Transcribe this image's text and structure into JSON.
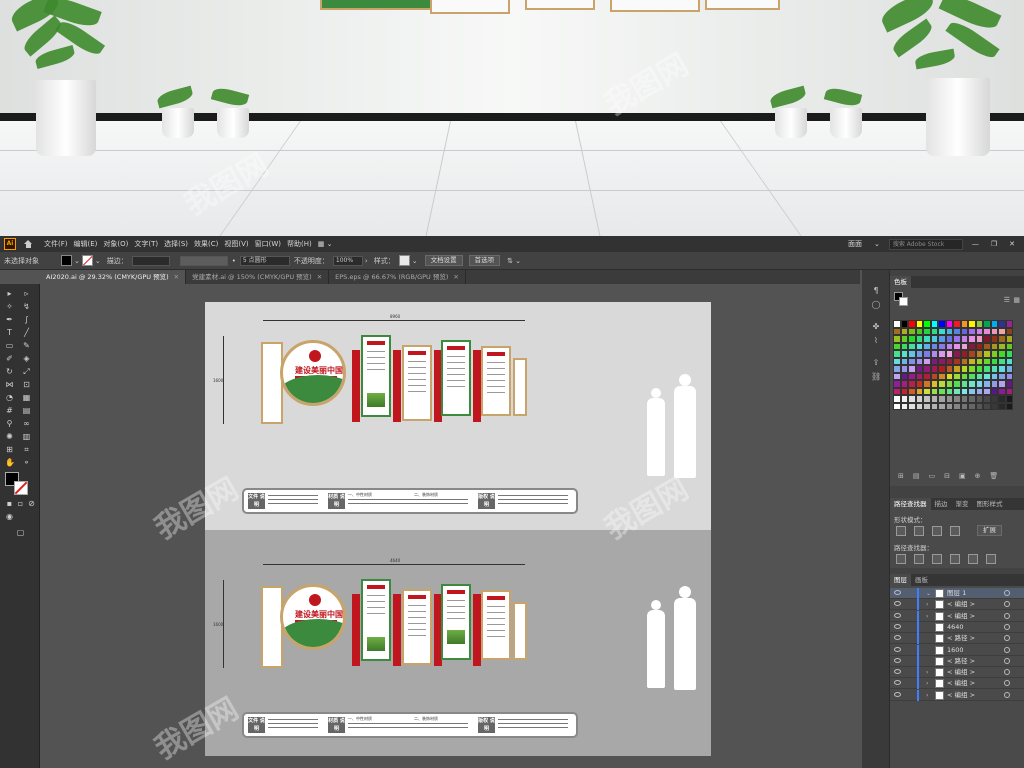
{
  "room": {
    "watermark": "我图网"
  },
  "menubar": {
    "app_logo": "Ai",
    "items": [
      "文件(F)",
      "编辑(E)",
      "对象(O)",
      "文字(T)",
      "选择(S)",
      "效果(C)",
      "视图(V)",
      "窗口(W)",
      "帮助(H)"
    ],
    "workspace": "面面",
    "search_placeholder": "搜索 Adobe Stock"
  },
  "control_bar": {
    "selection_status": "未选择对象",
    "stroke_label": "描边：",
    "brush_value": "5 点圆形",
    "opacity_label": "不透明度：",
    "opacity_value": "100%",
    "style_label": "样式：",
    "doc_setup_button": "文档设置",
    "preferences_button": "首选项"
  },
  "tabs": [
    {
      "label": "AI2020.ai @ 29.32% (CMYK/GPU 预览)",
      "active": true
    },
    {
      "label": "党建素材.ai @ 150% (CMYK/GPU 预览)",
      "active": false
    },
    {
      "label": "EPS.eps @ 66.67% (RGB/GPU 预览)",
      "active": false
    }
  ],
  "artboard1": {
    "width_dim": "8960",
    "height_dim": "1600",
    "emblem_title": "建设美丽中国",
    "legend_tags": [
      "文件\n说明",
      "材质\n说明",
      "版权\n说明"
    ],
    "legend_headings": [
      "一、中性材质",
      "二、装饰材质"
    ]
  },
  "artboard2": {
    "width_dim": "4640",
    "height_dim": "1600",
    "emblem_title": "建设美丽中国",
    "legend_tags": [
      "文件\n说明",
      "材质\n说明",
      "版权\n说明"
    ],
    "legend_headings": [
      "一、中性材质",
      "二、装饰材质"
    ]
  },
  "swatches_panel": {
    "tab": "色板"
  },
  "pathfinder_panel": {
    "tabs": [
      "路径查找器",
      "描边",
      "渐变",
      "图形样式"
    ],
    "shape_mode_label": "形状模式：",
    "expand_button": "扩展",
    "pathfinder_label": "路径查找器："
  },
  "layers_panel": {
    "tabs": [
      "图层",
      "画板"
    ],
    "rows": [
      {
        "name": "图层 1",
        "arrow": "⌄"
      },
      {
        "name": "< 编组 >",
        "arrow": "›"
      },
      {
        "name": "< 编组 >",
        "arrow": "›"
      },
      {
        "name": "4640",
        "arrow": ""
      },
      {
        "name": "< 路径 >",
        "arrow": ""
      },
      {
        "name": "1600",
        "arrow": ""
      },
      {
        "name": "< 路径 >",
        "arrow": ""
      },
      {
        "name": "< 编组 >",
        "arrow": "›"
      },
      {
        "name": "< 编组 >",
        "arrow": "›"
      },
      {
        "name": "< 编组 >",
        "arrow": "›"
      }
    ]
  },
  "colors": {
    "accent_red": "#c0161e",
    "accent_green": "#3b8a3e",
    "accent_gold": "#c9a46a",
    "selection_blue": "#3f7fff"
  }
}
